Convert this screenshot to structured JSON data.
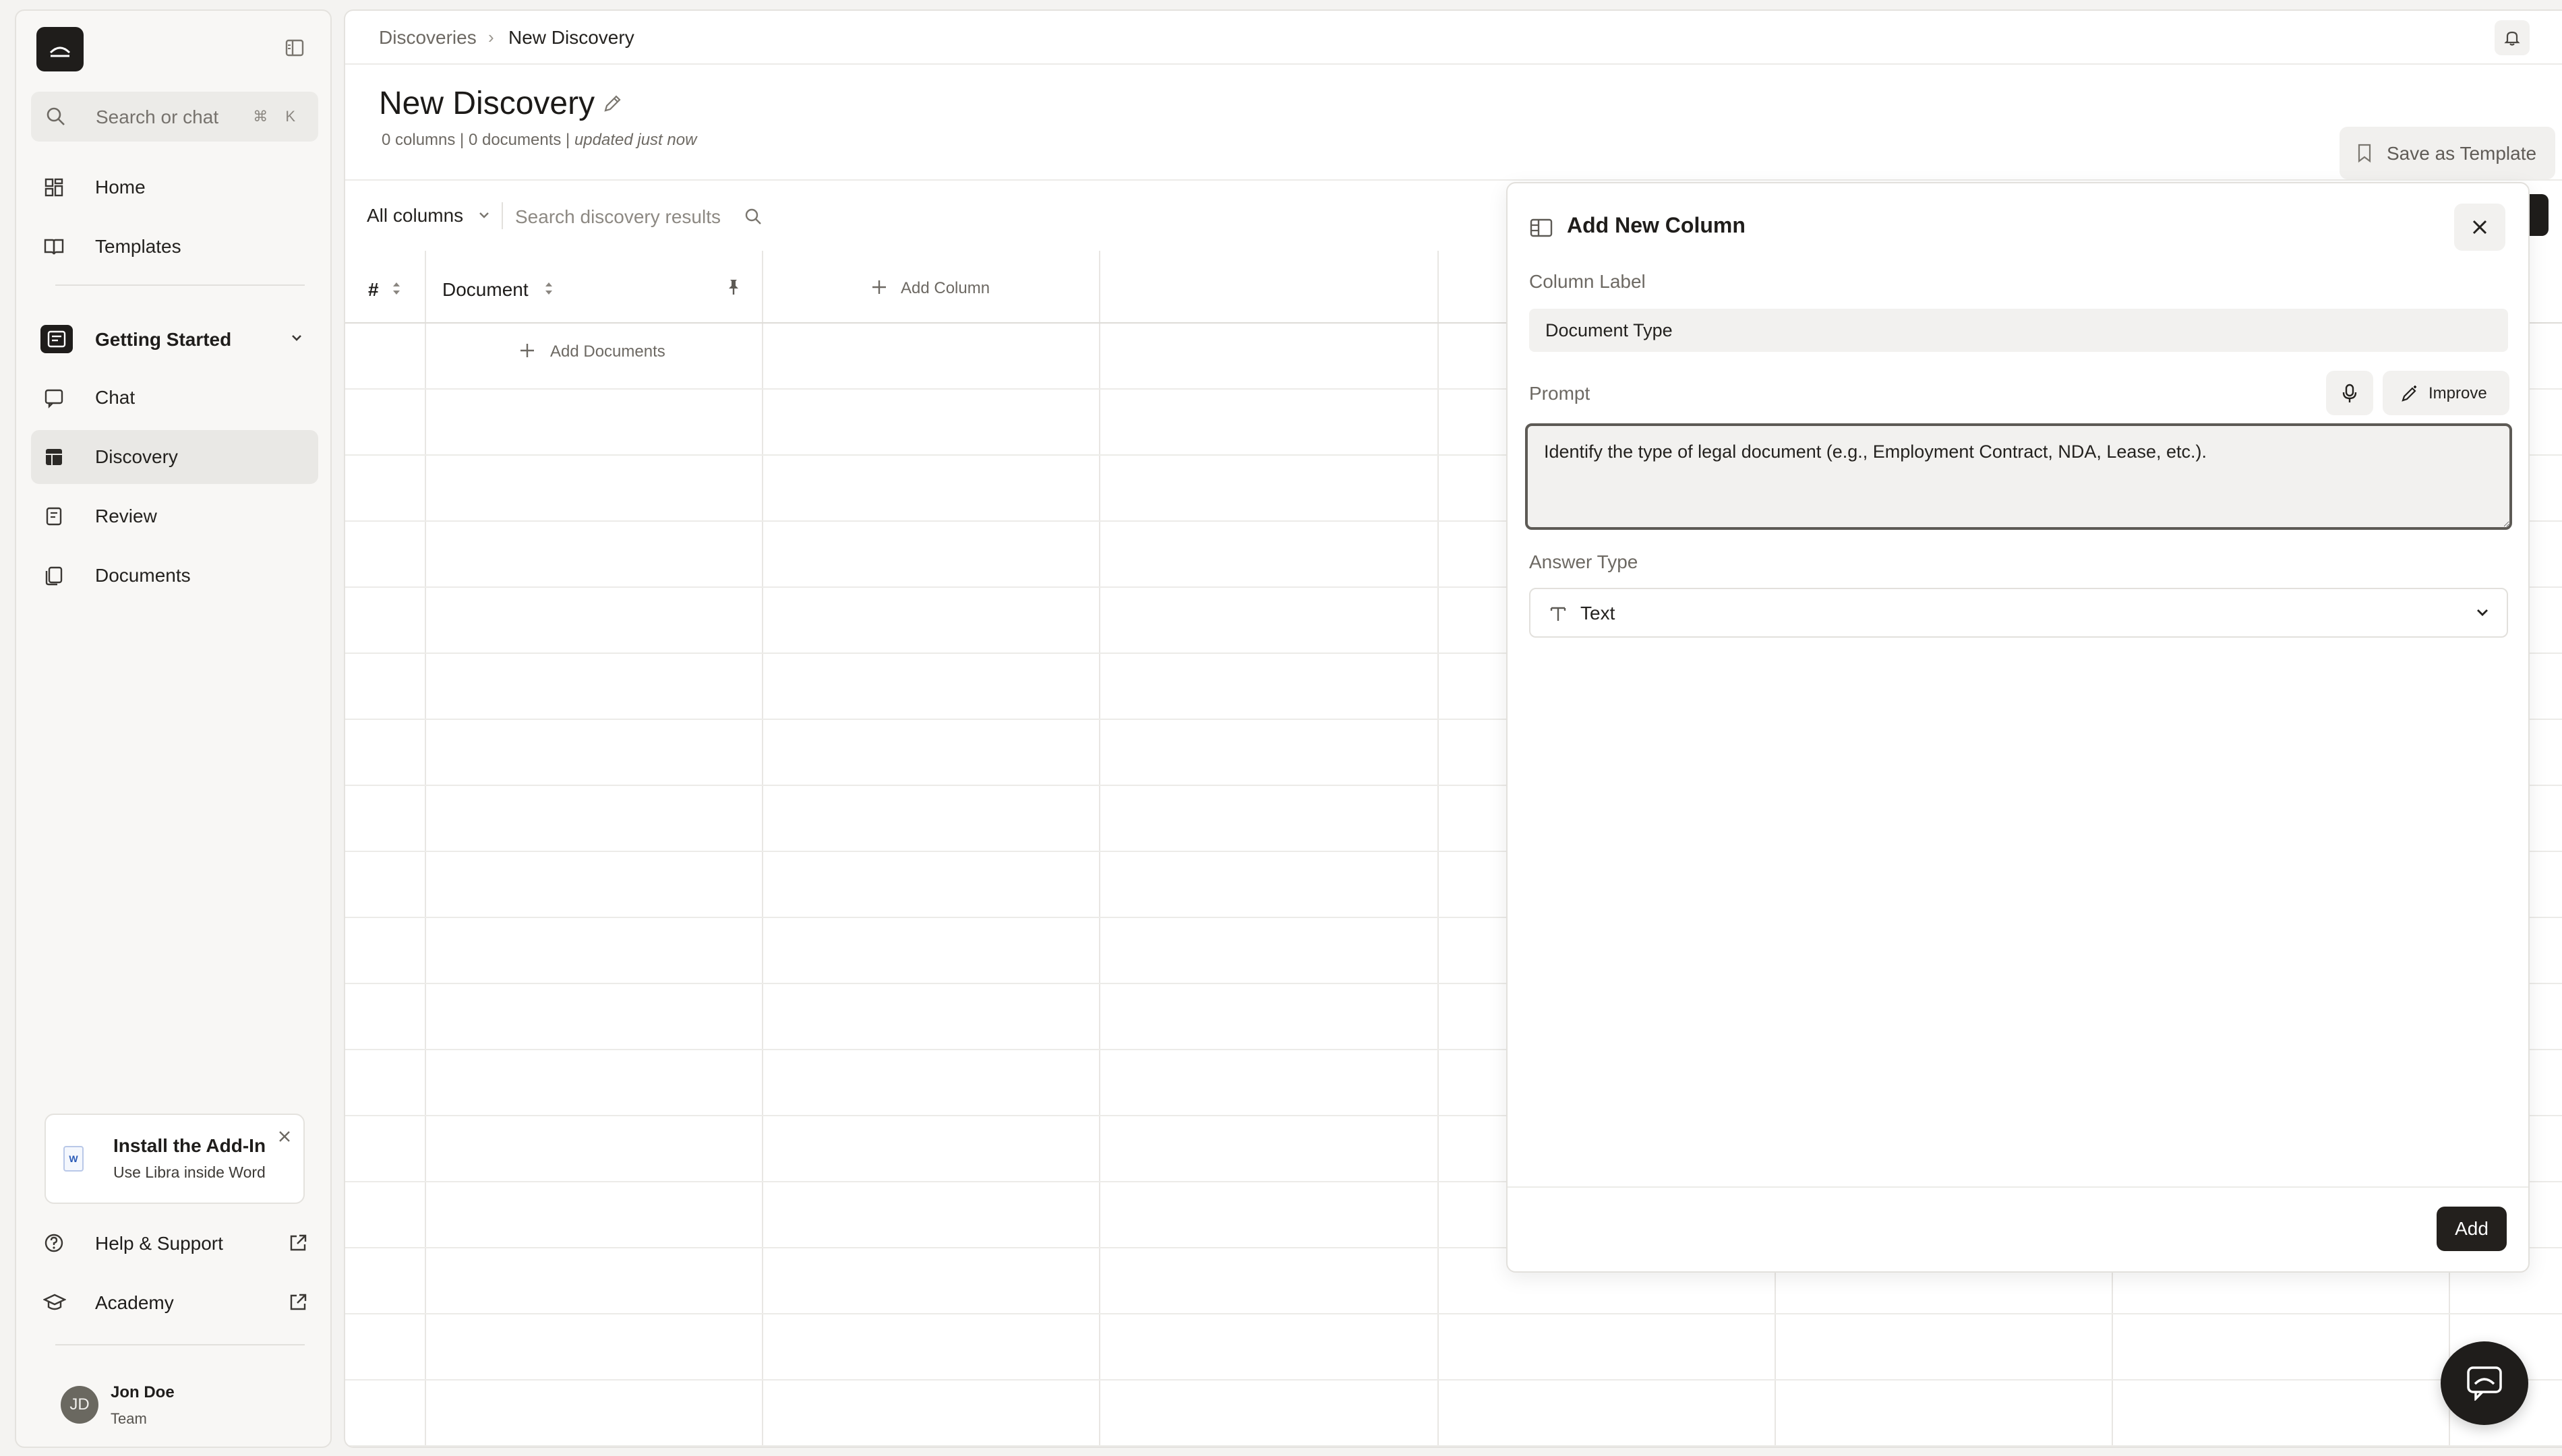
{
  "sidebar": {
    "search": {
      "placeholder": "Search or chat",
      "shortcut": "⌘ K"
    },
    "nav": [
      {
        "label": "Home",
        "icon": "home-grid-icon"
      },
      {
        "label": "Templates",
        "icon": "book-icon"
      }
    ],
    "group": {
      "label": "Getting Started",
      "items": [
        {
          "label": "Chat",
          "icon": "chat-icon"
        },
        {
          "label": "Discovery",
          "icon": "table-icon",
          "active": true
        },
        {
          "label": "Review",
          "icon": "review-icon"
        },
        {
          "label": "Documents",
          "icon": "documents-icon"
        }
      ]
    },
    "addin": {
      "title": "Install the Add-In",
      "subtitle": "Use Libra inside Word",
      "icon_text": "W"
    },
    "footer": [
      {
        "label": "Help & Support",
        "icon": "help-icon"
      },
      {
        "label": "Academy",
        "icon": "graduation-cap-icon"
      }
    ],
    "user": {
      "initials": "JD",
      "name": "Jon Doe",
      "team": "Team"
    }
  },
  "header": {
    "breadcrumb": [
      "Discoveries",
      "New Discovery"
    ],
    "title": "New Discovery",
    "meta_counts": "0 columns | 0 documents | ",
    "meta_updated": "updated just now",
    "save_template": "Save as Template"
  },
  "toolbar": {
    "columns_filter": "All columns",
    "search_placeholder": "Search discovery results"
  },
  "table": {
    "col_number": "#",
    "col_document": "Document",
    "add_column": "Add Column",
    "add_documents": "Add Documents"
  },
  "panel": {
    "title": "Add New Column",
    "column_label_heading": "Column Label",
    "column_label_value": "Document Type",
    "prompt_heading": "Prompt",
    "improve_label": "Improve",
    "prompt_value": "Identify the type of legal document (e.g., Employment Contract, NDA, Lease, etc.).",
    "answer_type_heading": "Answer Type",
    "answer_type_value": "Text",
    "add_label": "Add"
  },
  "colors": {
    "accent_dark": "#1f1d1b",
    "background": "#f4f3f1",
    "surface": "#ffffff"
  }
}
